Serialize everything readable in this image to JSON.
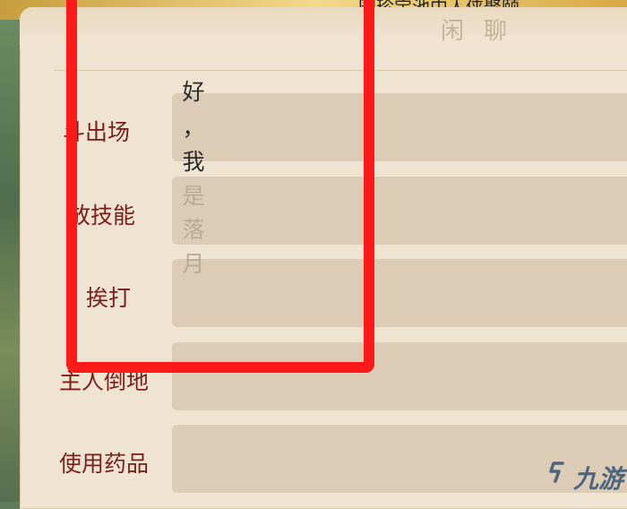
{
  "banner": {
    "text": "…园珍宝池中人侠聚颐，"
  },
  "dialog": {
    "title": "闲聊"
  },
  "rows": [
    {
      "label": "斗出场"
    },
    {
      "label": "放技能"
    },
    {
      "label": "挨打"
    },
    {
      "label": "主人倒地"
    },
    {
      "label": "使用药品"
    }
  ],
  "input_text": {
    "typed": [
      "好",
      "，",
      "我"
    ],
    "placeholder": [
      "是",
      "落",
      "月"
    ]
  },
  "colors": {
    "label": "#7a1f1a",
    "annotation": "#ff1a1a",
    "field": "#dccbb5",
    "panel": "#efe3d1"
  },
  "watermark": {
    "text": "九游"
  }
}
